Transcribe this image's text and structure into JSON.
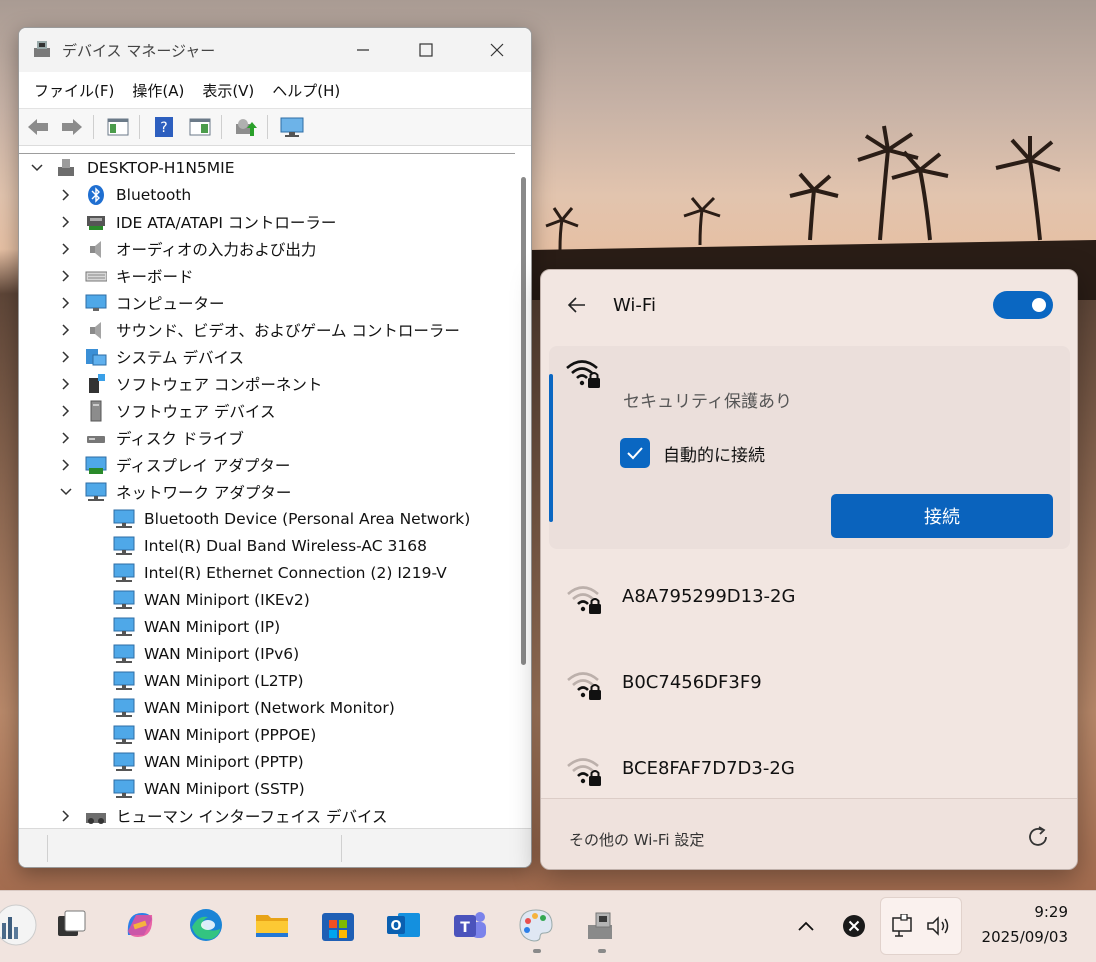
{
  "device_manager": {
    "title": "デバイス マネージャー",
    "menu": [
      "ファイル(F)",
      "操作(A)",
      "表示(V)",
      "ヘルプ(H)"
    ],
    "toolbar_icons": [
      "back-arrow-icon",
      "forward-arrow-icon",
      "show-hide-tree-icon",
      "help-icon",
      "properties-icon",
      "update-driver-icon",
      "monitor-icon"
    ],
    "tree": {
      "root": "DESKTOP-H1N5MIE",
      "categories": [
        {
          "label": "Bluetooth",
          "icon": "bluetooth-icon"
        },
        {
          "label": "IDE ATA/ATAPI コントローラー",
          "icon": "ide-controller-icon"
        },
        {
          "label": "オーディオの入力および出力",
          "icon": "speaker-icon"
        },
        {
          "label": "キーボード",
          "icon": "keyboard-icon"
        },
        {
          "label": "コンピューター",
          "icon": "computer-icon"
        },
        {
          "label": "サウンド、ビデオ、およびゲーム コントローラー",
          "icon": "speaker-icon"
        },
        {
          "label": "システム デバイス",
          "icon": "system-devices-icon"
        },
        {
          "label": "ソフトウェア コンポーネント",
          "icon": "software-component-icon"
        },
        {
          "label": "ソフトウェア デバイス",
          "icon": "software-device-icon"
        },
        {
          "label": "ディスク ドライブ",
          "icon": "disk-drive-icon"
        },
        {
          "label": "ディスプレイ アダプター",
          "icon": "display-adapter-icon"
        },
        {
          "label": "ネットワーク アダプター",
          "icon": "network-adapter-icon"
        }
      ],
      "network_adapters": [
        "Bluetooth Device (Personal Area Network)",
        "Intel(R) Dual Band Wireless-AC 3168",
        "Intel(R) Ethernet Connection (2) I219-V",
        "WAN Miniport (IKEv2)",
        "WAN Miniport (IP)",
        "WAN Miniport (IPv6)",
        "WAN Miniport (L2TP)",
        "WAN Miniport (Network Monitor)",
        "WAN Miniport (PPPOE)",
        "WAN Miniport (PPTP)",
        "WAN Miniport (SSTP)"
      ],
      "after": "ヒューマン インターフェイス デバイス"
    }
  },
  "wifi": {
    "title": "Wi-Fi",
    "toggle_on": true,
    "selected": {
      "security": "セキュリティ保護あり",
      "auto_connect_label": "自動的に接続",
      "auto_connect_checked": true,
      "connect_label": "接続"
    },
    "networks": [
      "A8A795299D13-2G",
      "B0C7456DF3F9",
      "BCE8FAF7D7D3-2G"
    ],
    "more_settings": "その他の Wi-Fi 設定"
  },
  "taskbar": {
    "apps": [
      "widgets-icon",
      "task-view-icon",
      "copilot-icon",
      "edge-icon",
      "file-explorer-icon",
      "store-icon",
      "outlook-icon",
      "teams-icon",
      "paint-icon",
      "device-manager-icon"
    ],
    "time": "9:29",
    "date": "2025/09/03"
  },
  "colors": {
    "accent": "#0a67c2",
    "flyout_bg": "#f2e6e1",
    "taskbar_bg": "#f1e4df"
  }
}
